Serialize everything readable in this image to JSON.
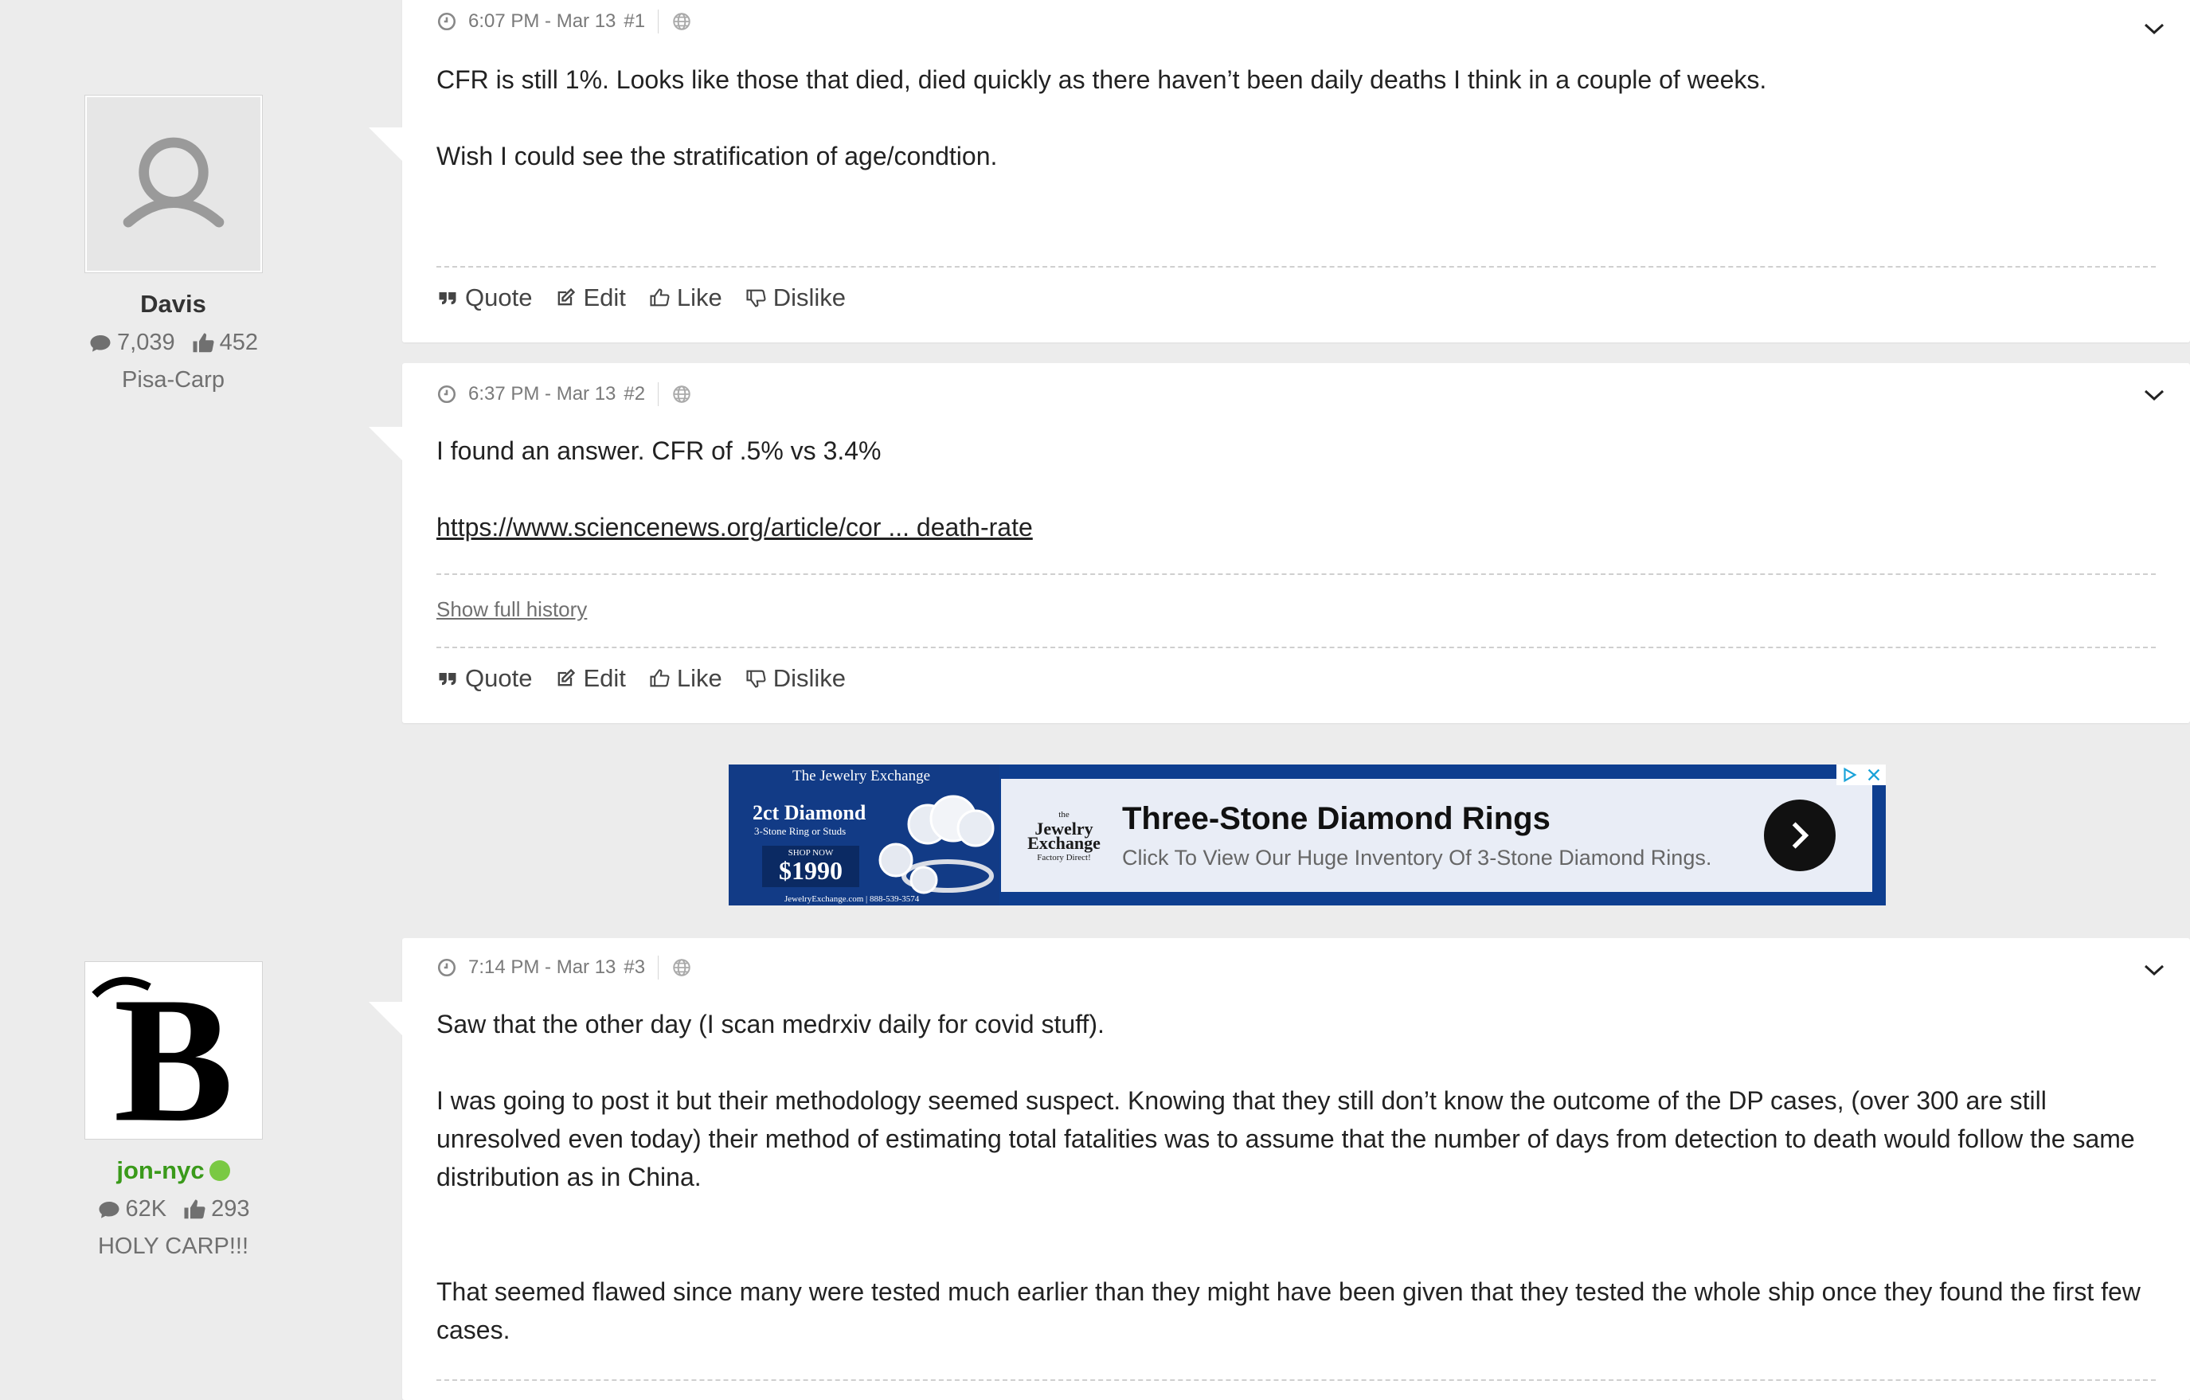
{
  "users": [
    {
      "name": "Davis",
      "posts": "7,039",
      "likes": "452",
      "title": "Pisa-Carp"
    },
    {
      "name": "jon-nyc",
      "posts": "62K",
      "likes": "293",
      "title": "HOLY CARP!!!"
    }
  ],
  "posts": [
    {
      "time": "6:07 PM - Mar 13",
      "number": "#1",
      "paragraphs": [
        "CFR is still 1%.    Looks like those that died, died quickly as there haven’t been daily deaths I think in a couple of weeks.",
        "Wish I could see the stratification of age/condtion."
      ]
    },
    {
      "time": "6:37 PM - Mar 13",
      "number": "#2",
      "text": "I found an answer.  CFR of   .5% vs 3.4%",
      "link": "https://www.sciencenews.org/article/cor ... death-rate",
      "history": "Show full history"
    },
    {
      "time": "7:14 PM - Mar 13",
      "number": "#3",
      "paragraphs": [
        "Saw that the other day (I scan medrxiv daily for covid stuff).",
        "I was going to post it but their methodology seemed suspect. Knowing that they still don’t know the outcome of the DP cases, (over 300 are still unresolved even today) their method of estimating total fatalities was to assume that the number of days from detection to death would follow the same distribution as in China.",
        "That seemed flawed since many were tested much earlier than they might have been given that they tested the whole ship once they found the first few cases."
      ]
    }
  ],
  "actions": {
    "quote": "Quote",
    "edit": "Edit",
    "like": "Like",
    "dislike": "Dislike"
  },
  "ad": {
    "brand": "The Jewelry Exchange",
    "offer": "2ct Diamond",
    "offer_sub": "3-Stone Ring or Studs",
    "shop_now": "SHOP NOW",
    "price": "$1990",
    "url": "JewelryExchange.com | 888-539-3574",
    "logo_the": "the",
    "logo_main": "Jewelry Exchange",
    "logo_tag": "Factory Direct!",
    "title": "Three-Stone Diamond Rings",
    "description": "Click To View Our Huge Inventory Of 3-Stone Diamond Rings."
  },
  "colors": {
    "page_bg": "#ececec",
    "online": "#7ac943",
    "username_green": "#3a9a1a",
    "ad_blue": "#0e3e8f"
  }
}
